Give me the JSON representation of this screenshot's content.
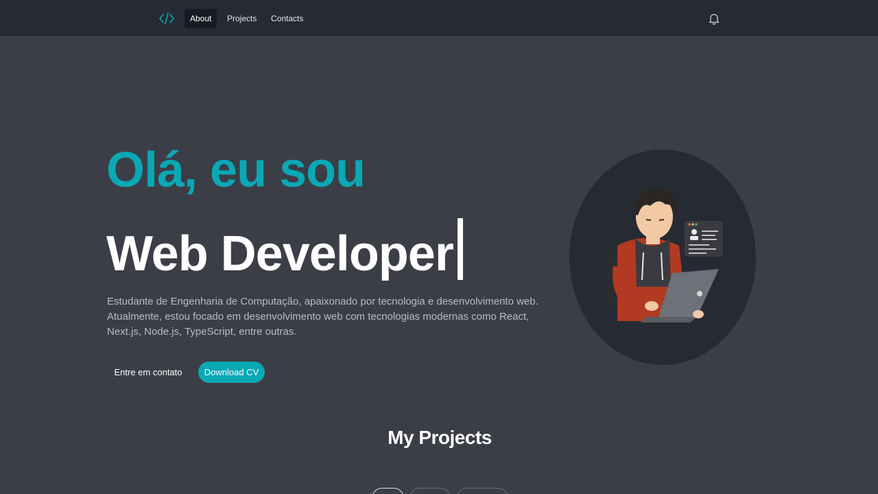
{
  "nav": {
    "logo_icon": "code-icon",
    "items": [
      {
        "label": "About",
        "active": true
      },
      {
        "label": "Projects",
        "active": false
      },
      {
        "label": "Contacts",
        "active": false
      }
    ],
    "notification_icon": "bell-icon"
  },
  "hero": {
    "greeting": "Olá, eu sou",
    "role": "Web Developer",
    "description": "Estudante de Engenharia de Computação, apaixonado por tecnologia e desenvolvimento web. Atualmente, estou focado em desenvolvimento web com tecnologias modernas como React, Next.js, Node.js, TypeScript, entre outras.",
    "contact_button": "Entre em contato",
    "download_button": "Download CV"
  },
  "projects": {
    "title": "My Projects"
  },
  "colors": {
    "accent": "#0aa8b5",
    "background": "#3b3e47",
    "navbar": "#262a33"
  }
}
